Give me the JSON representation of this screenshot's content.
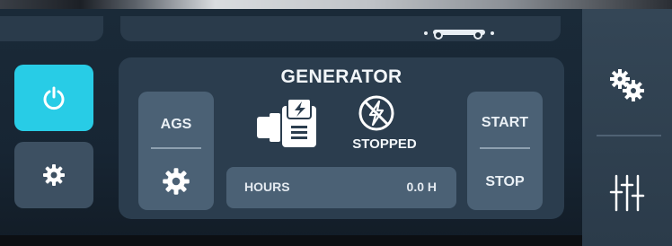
{
  "generator": {
    "title": "GENERATOR",
    "status": "STOPPED",
    "ags_label": "AGS",
    "start_label": "START",
    "stop_label": "STOP",
    "hours_label": "HOURS",
    "hours_value": "0.0 H"
  },
  "icons": {
    "power": "power-icon",
    "settings": "gear-icon",
    "ags_settings": "gear-icon",
    "generator": "generator-icon",
    "no_power": "no-power-icon",
    "sidebar_settings": "gears-icon",
    "sidebar_sliders": "sliders-icon",
    "link": "link-icon"
  },
  "colors": {
    "accent": "#28cce6",
    "panel": "#2b3d4e",
    "button": "#4b6175"
  }
}
